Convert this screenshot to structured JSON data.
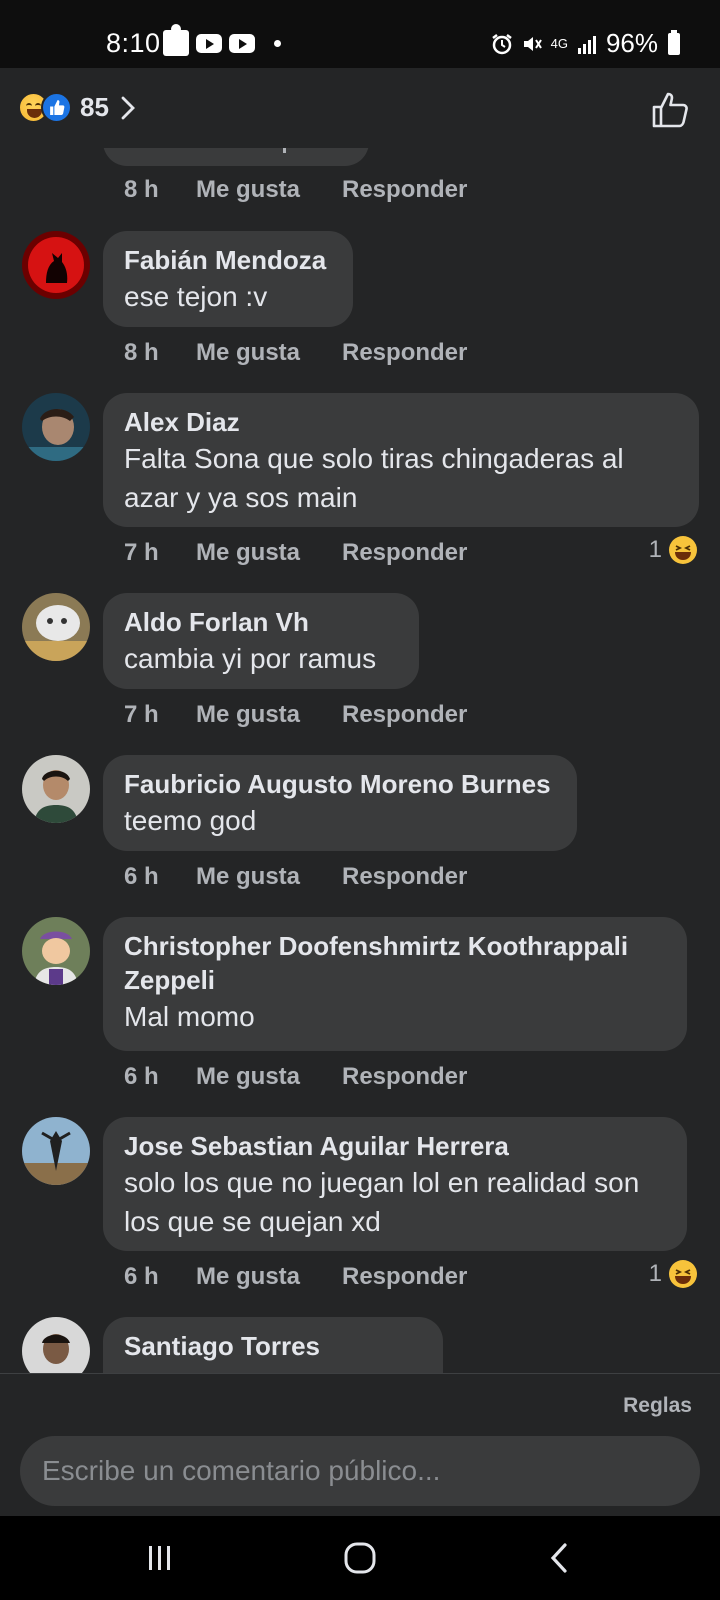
{
  "status_bar": {
    "time": "8:10",
    "network": "4G",
    "battery": "96%",
    "icons": [
      "puzzle-icon",
      "youtube-icon",
      "youtube-icon",
      "dot-icon",
      "alarm-icon",
      "mute-icon",
      "signal-icon",
      "battery-icon"
    ]
  },
  "header": {
    "reaction_count": "85",
    "reaction_icons": [
      "haha-icon",
      "like-icon"
    ]
  },
  "actions": {
    "like": "Me gusta",
    "reply": "Responder"
  },
  "top_meta": {
    "time": "8 h"
  },
  "comments": [
    {
      "author": "Fabián Mendoza",
      "text": "ese tejon :v",
      "time": "8 h",
      "reactions": "",
      "avatar": "wolf-avatar"
    },
    {
      "author": "Alex Diaz",
      "text": "Falta Sona que solo tiras chingaderas al azar y ya sos main",
      "time": "7 h",
      "reactions": "1",
      "avatar": "person-avatar"
    },
    {
      "author": "Aldo Forlan Vh",
      "text": "cambia yi por ramus",
      "time": "7 h",
      "reactions": "",
      "avatar": "cat-avatar"
    },
    {
      "author": "Faubricio Augusto Moreno Burnes",
      "text": "teemo god",
      "time": "6 h",
      "reactions": "",
      "avatar": "person-avatar"
    },
    {
      "author": "Christopher Doofenshmirtz Koothrappali Zeppeli",
      "text": "Mal momo",
      "time": "6 h",
      "reactions": "",
      "avatar": "cartoon-avatar"
    },
    {
      "author": "Jose Sebastian Aguilar Herrera",
      "text": "solo los que no juegan lol en realidad son los que se quejan xd",
      "time": "6 h",
      "reactions": "1",
      "avatar": "figure-avatar"
    },
    {
      "author": "Santiago Torres",
      "text": "",
      "time": "",
      "reactions": "",
      "avatar": "person-avatar"
    }
  ],
  "composer": {
    "rules": "Reglas",
    "placeholder": "Escribe un comentario público..."
  },
  "colors": {
    "background": "#242526",
    "bubble": "#3a3b3c",
    "secondary_text": "#b0b3b8",
    "like_blue": "#1b74e4"
  }
}
